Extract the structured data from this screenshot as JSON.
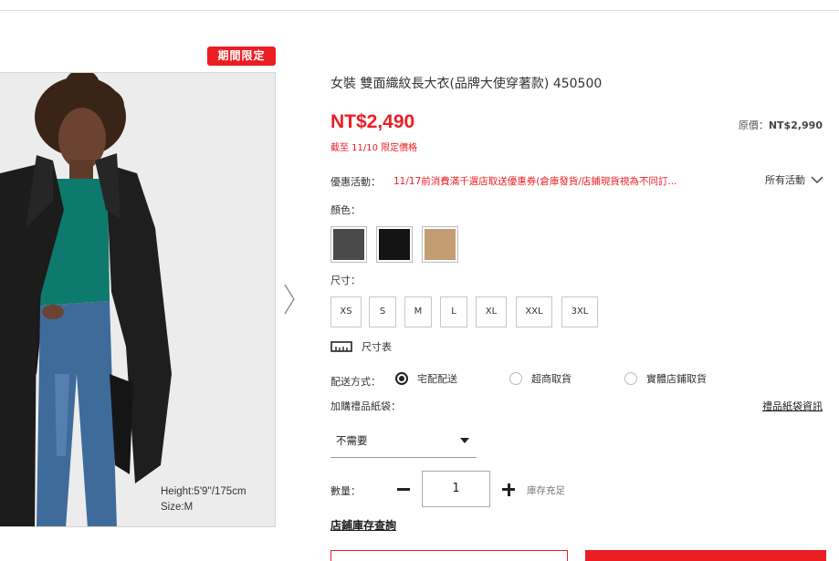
{
  "badge": "期間限定",
  "product": {
    "title": "女裝 雙面織紋長大衣(品牌大使穿著款) 450500",
    "price": "NT$2,490",
    "limited_until": "截至 11/10 限定價格",
    "original_label": "原價：",
    "original_price": "NT$2,990"
  },
  "photo": {
    "caption_height": "Height:5'9''/175cm",
    "caption_size": "Size:M"
  },
  "promo": {
    "label": "優惠活動：",
    "text": "11/17前消費滿千選店取送優惠券(倉庫發貨/店鋪現貨視為不同訂...",
    "all_label": "所有活動"
  },
  "color": {
    "label": "顏色：",
    "swatches": [
      {
        "name": "dark-gray",
        "hex": "#4a4a4a"
      },
      {
        "name": "black",
        "hex": "#141414"
      },
      {
        "name": "beige",
        "hex": "#c39d73"
      }
    ]
  },
  "size": {
    "label": "尺寸：",
    "options": [
      "XS",
      "S",
      "M",
      "L",
      "XL",
      "XXL",
      "3XL"
    ],
    "chart_label": "尺寸表"
  },
  "shipping": {
    "label": "配送方式：",
    "options": [
      "宅配配送",
      "超商取貨",
      "實體店鋪取貨"
    ],
    "selected": "宅配配送"
  },
  "gift_bag": {
    "label": "加購禮品紙袋：",
    "info_link": "禮品紙袋資訊",
    "selected": "不需要"
  },
  "quantity": {
    "label": "數量：",
    "value": "1",
    "stock": "庫存充足"
  },
  "store_stock_link": "店鋪庫存查詢",
  "colors": {
    "accent": "#ed1d24"
  }
}
